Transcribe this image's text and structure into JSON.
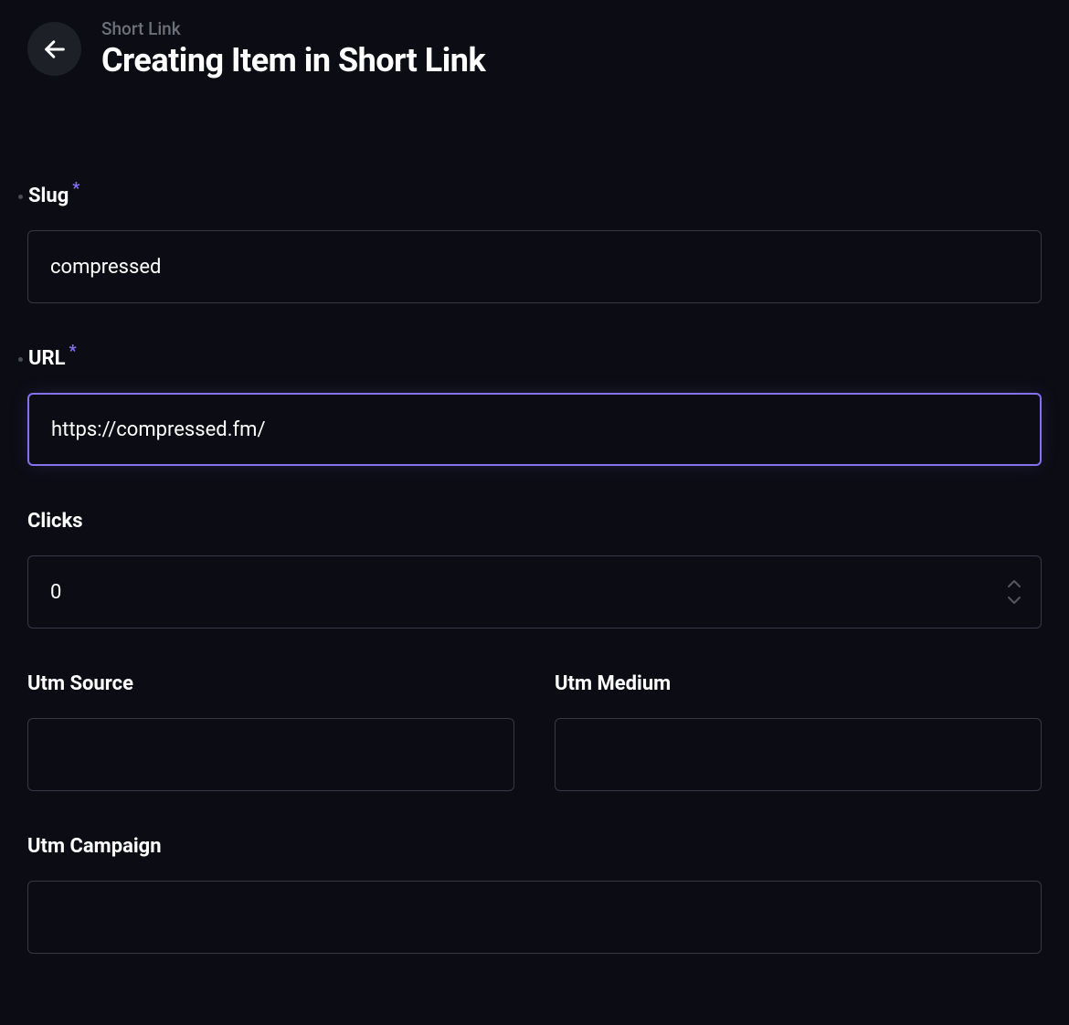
{
  "header": {
    "breadcrumb": "Short Link",
    "title": "Creating Item in Short Link"
  },
  "form": {
    "slug": {
      "label": "Slug",
      "required": true,
      "value": "compressed",
      "hasDot": true
    },
    "url": {
      "label": "URL",
      "required": true,
      "value": "https://compressed.fm/",
      "focused": true,
      "hasDot": true
    },
    "clicks": {
      "label": "Clicks",
      "required": false,
      "value": "0",
      "hasDot": false
    },
    "utmSource": {
      "label": "Utm Source",
      "required": false,
      "value": "",
      "hasDot": false
    },
    "utmMedium": {
      "label": "Utm Medium",
      "required": false,
      "value": "",
      "hasDot": false
    },
    "utmCampaign": {
      "label": "Utm Campaign",
      "required": false,
      "value": "",
      "hasDot": false
    }
  },
  "requiredMark": "*"
}
